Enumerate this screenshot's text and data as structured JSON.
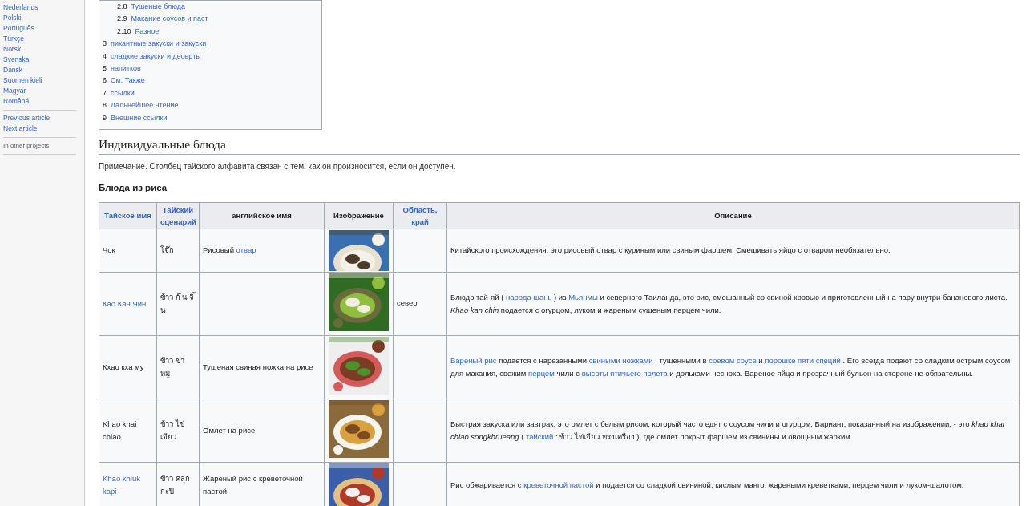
{
  "sidebar": {
    "languages": [
      "Nederlands",
      "Polski",
      "Português",
      "Türkçe",
      "Norsk",
      "Svenska",
      "Dansk",
      "Suomen kieli",
      "Magyar",
      "Română"
    ],
    "navigation": [
      "Previous article",
      "Next article"
    ],
    "section_heading": "In other projects"
  },
  "toc": {
    "sub_items": [
      {
        "number": "2.8",
        "label": "Тушеные блюда"
      },
      {
        "number": "2.9",
        "label": "Макание соусов и паст"
      },
      {
        "number": "2.10",
        "label": "Разное"
      }
    ],
    "items": [
      {
        "number": "3",
        "label": "пикантные закуски и закуски"
      },
      {
        "number": "4",
        "label": "сладкие закуски и десерты"
      },
      {
        "number": "5",
        "label": "напитков"
      },
      {
        "number": "6",
        "label": "См. Также"
      },
      {
        "number": "7",
        "label": "ссылки"
      },
      {
        "number": "8",
        "label": "Дальнейшее чтение"
      },
      {
        "number": "9",
        "label": "Внешние ссылки"
      }
    ]
  },
  "section_title": "Индивидуальные блюда",
  "note": "Примечание. Столбец тайского алфавита связан с тем, как он произносится, если он доступен.",
  "subsection_title": "Блюда из риса",
  "table": {
    "columns": [
      {
        "label": "Тайское имя",
        "link": true
      },
      {
        "label": "Тайский сценарий",
        "link": true
      },
      {
        "label": "английское имя",
        "link": false
      },
      {
        "label": "Изображение",
        "link": false
      },
      {
        "label": "Область, край",
        "link": true
      },
      {
        "label": "Описание",
        "link": false
      }
    ],
    "rows": [
      {
        "thai_name": {
          "text": "Чок",
          "link": false
        },
        "thai_script": "โจ๊ก",
        "english_name": [
          {
            "kind": "plain",
            "text": "Рисовый "
          },
          {
            "kind": "link",
            "text": "отвар"
          }
        ],
        "image": {
          "kind": "picture"
        },
        "description": [
          {
            "kind": "plain",
            "text": "Китайского происхождения, это рисовый отвар с куриным или свиным фаршем. Смешивать яйцо с отваром необязательно."
          }
        ]
      },
      {
        "thai_name": {
          "text": "Као Кан Чин",
          "link": true
        },
        "thai_script": "ข้าว ก๊ น จิ๊ น",
        "image": {
          "kind": "picture"
        },
        "region": "север",
        "description": [
          {
            "kind": "plain",
            "text": "Блюдо тай-яй ( "
          },
          {
            "kind": "link",
            "text": "народа шань"
          },
          {
            "kind": "plain",
            "text": " ) из "
          },
          {
            "kind": "link",
            "text": "Мьянмы"
          },
          {
            "kind": "plain",
            "text": " и северного Таиланда, это рис, смешанный со свиной кровью и приготовленный на пару внутри бананового листа. "
          },
          {
            "kind": "italic",
            "text": "Khao kan chin"
          },
          {
            "kind": "plain",
            "text": " подается с огурцом, луком и жареным сушеным перцем чили."
          }
        ]
      },
      {
        "thai_name": {
          "text": "Кхао кха му",
          "link": false
        },
        "thai_script": "ข้าว ขา หมู",
        "english_name": [
          {
            "kind": "plain",
            "text": "Тушеная свиная ножка на рисе"
          }
        ],
        "image": {
          "kind": "picture"
        },
        "description": [
          {
            "kind": "link",
            "text": "Вареный рис"
          },
          {
            "kind": "plain",
            "text": " подается с нарезанными "
          },
          {
            "kind": "link",
            "text": "свиными ножками"
          },
          {
            "kind": "plain",
            "text": " , тушенными в "
          },
          {
            "kind": "link",
            "text": "соевом соусе"
          },
          {
            "kind": "plain",
            "text": " и "
          },
          {
            "kind": "link",
            "text": "порошке пяти специй"
          },
          {
            "kind": "plain",
            "text": " . Его всегда подают со сладким острым соусом для макания, свежим "
          },
          {
            "kind": "link",
            "text": "перцем"
          },
          {
            "kind": "plain",
            "text": " чили с "
          },
          {
            "kind": "link",
            "text": "высоты птичьего полета"
          },
          {
            "kind": "plain",
            "text": " и дольками чеснока. Вареное яйцо и прозрачный бульон на стороне не обязательны."
          }
        ]
      },
      {
        "thai_name": {
          "text": "Khao khai chiao",
          "link": false
        },
        "thai_script": "ข้าว ไข่ เจียว",
        "english_name": [
          {
            "kind": "plain",
            "text": "Омлет на рисе"
          }
        ],
        "image": {
          "kind": "picture"
        },
        "description": [
          {
            "kind": "plain",
            "text": "Быстрая закуска или завтрак, это омлет с белым рисом, который часто едят с соусом чили и огурцом. Вариант, показанный на изображении, - это "
          },
          {
            "kind": "italic",
            "text": "khao khai chiao songkhrueang"
          },
          {
            "kind": "plain",
            "text": " ( "
          },
          {
            "kind": "link",
            "text": "тайский"
          },
          {
            "kind": "plain",
            "text": " : ข้าว ไข่เจียว ทรงเครื่อง ), где омлет покрыт фаршем из свинины и овощным жарким."
          }
        ]
      },
      {
        "thai_name": {
          "text": "Khao khluk kapi",
          "link": true
        },
        "thai_script": "ข้าว คลุก กะปิ",
        "english_name": [
          {
            "kind": "plain",
            "text": "Жареный рис с креветочной пастой"
          }
        ],
        "image": {
          "kind": "picture"
        },
        "description": [
          {
            "kind": "plain",
            "text": "Рис обжаривается с "
          },
          {
            "kind": "link",
            "text": "креветочной пастой"
          },
          {
            "kind": "plain",
            "text": " и подается со сладкой свининой, кислым манго, жареными креветками, перцем чили и луком-шалотом."
          }
        ]
      }
    ]
  }
}
